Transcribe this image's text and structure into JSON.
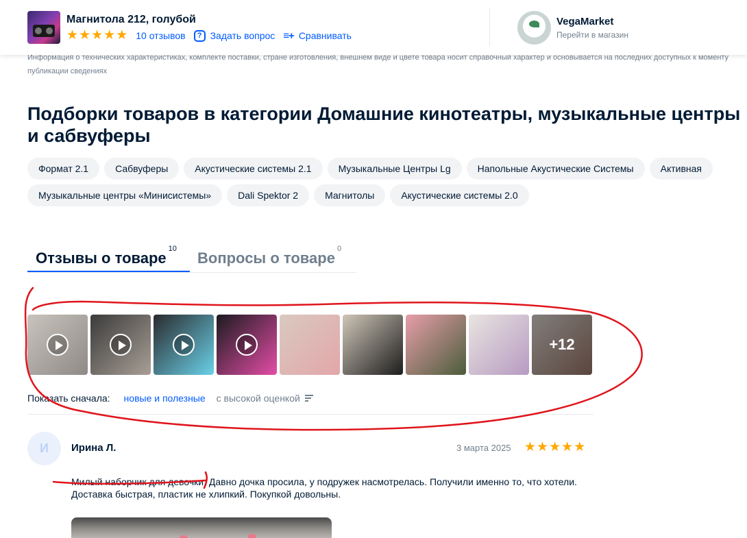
{
  "header": {
    "product_title": "Магнитола 212, голубой",
    "rating_stars": 5,
    "reviews_link": "10 отзывов",
    "ask_question": "Задать вопрос",
    "compare": "Сравнивать",
    "shop_name": "VegaMarket",
    "shop_link": "Перейти в магазин",
    "shop_logo_text": "VegaMarket"
  },
  "disclaimer": "Информация о технических характеристиках, комплекте поставки, стране изготовления, внешнем виде и цвете товара носит справочный характер и основывается на последних доступных к моменту публикации сведениях",
  "collections": {
    "title": "Подборки товаров в категории Домашние кинотеатры, музыкальные центры и сабвуферы",
    "chips": [
      "Формат 2.1",
      "Сабвуферы",
      "Акустические системы 2.1",
      "Музыкальные Центры Lg",
      "Напольные Акустические Системы",
      "Активная",
      "Музыкальные центры «Минисистемы»",
      "Dali Spektor 2",
      "Магнитолы",
      "Акустические системы 2.0"
    ]
  },
  "tabs": {
    "reviews_label": "Отзывы о товаре",
    "reviews_count": "10",
    "questions_label": "Вопросы о товаре",
    "questions_count": "0"
  },
  "media": {
    "more_label": "+12",
    "items": [
      {
        "kind": "video",
        "colors": [
          "#c9c3bd",
          "#8f8a86"
        ]
      },
      {
        "kind": "video",
        "colors": [
          "#3b3b3b",
          "#a89f96"
        ]
      },
      {
        "kind": "video",
        "colors": [
          "#2a2a2e",
          "#6ad1e8"
        ]
      },
      {
        "kind": "video",
        "colors": [
          "#1b1b1f",
          "#e44da6"
        ]
      },
      {
        "kind": "photo",
        "colors": [
          "#d9c9c0",
          "#e3a6a9"
        ]
      },
      {
        "kind": "photo",
        "colors": [
          "#cfc6b8",
          "#1d1d1d"
        ]
      },
      {
        "kind": "photo",
        "colors": [
          "#e79eaa",
          "#4b5d3a"
        ]
      },
      {
        "kind": "photo",
        "colors": [
          "#e8e4e0",
          "#b79bc2"
        ]
      },
      {
        "kind": "photo",
        "colors": [
          "#c8c2be",
          "#8b6b5e"
        ]
      }
    ]
  },
  "sort": {
    "label": "Показать сначала:",
    "option_active": "новые и полезные",
    "option_other": "с высокой оценкой"
  },
  "review": {
    "avatar_letter": "И",
    "author": "Ирина Л.",
    "date": "3 марта 2025",
    "stars": 5,
    "text": "Милый наборчик для девочки. Давно дочка просила, у подружек насмотрелась. Получили именно то, что хотели. Доставка быстрая, пластик не хлипкий. Покупкой довольны."
  },
  "colors": {
    "accent": "#005bff",
    "star": "#ffa800",
    "annotation": "#e0141c"
  }
}
